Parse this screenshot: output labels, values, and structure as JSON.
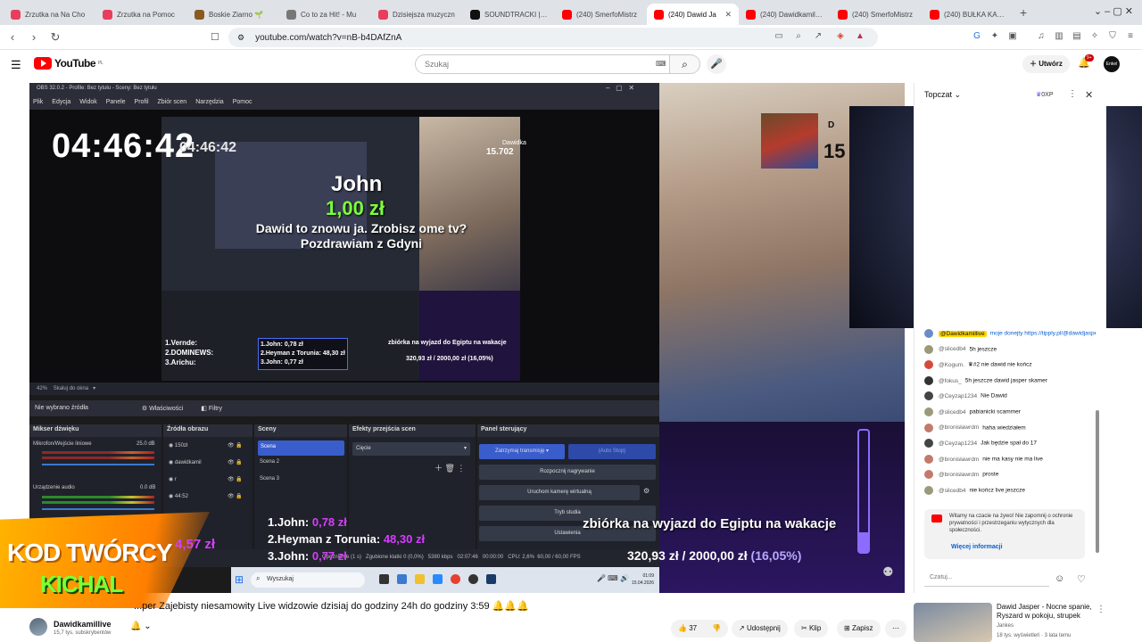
{
  "browser": {
    "tabs": [
      {
        "label": "Zrzutka na Na Cho",
        "color": "#e83e5c"
      },
      {
        "label": "Zrzutka na Pomoc",
        "color": "#e83e5c"
      },
      {
        "label": "Boskie Ziarno 🌱",
        "color": "#8a5a20"
      },
      {
        "label": "Co to za Hit! - Mu",
        "color": "#777777"
      },
      {
        "label": "Dzisiejsza muzyczn",
        "color": "#e83e5c"
      },
      {
        "label": "SOUNDTRACKI | Ja",
        "color": "#111111"
      },
      {
        "label": "(240) SmerfoMistrz",
        "color": "#ff0000"
      },
      {
        "label": "(240) Dawid Ja",
        "color": "#ff0000",
        "active": true
      },
      {
        "label": "(240) Dawidkamillive",
        "color": "#ff0000"
      },
      {
        "label": "(240) SmerfoMistrz",
        "color": "#ff0000"
      },
      {
        "label": "(240) BUŁKA KARU",
        "color": "#ff0000"
      }
    ],
    "url": "youtube.com/watch?v=nB-b4DAfZnA"
  },
  "youtube": {
    "logo": "YouTube",
    "logo_country": "PL",
    "search_placeholder": "Szukaj",
    "create_label": "Utwórz",
    "notif_count": "9+",
    "avatar_text": "Enkel"
  },
  "obs": {
    "title": "OBS 32.0.2 - Profile: Bez tytułu - Sceny: Bez tytułu",
    "menu": [
      "Plik",
      "Edycja",
      "Widok",
      "Panele",
      "Profil",
      "Zbiór scen",
      "Narzędzia",
      "Pomoc"
    ],
    "clock": "04:46:42",
    "clock_small": "04:46:42",
    "status_zoom": "42%",
    "status_fit": "Skaluj do okna",
    "no_source": "Nie wybrano źródła",
    "props": "Właściwości",
    "filters": "Filtry",
    "panel_mixer": "Mikser dźwięku",
    "mic_label": "Mikrofon/Wejście liniowe",
    "mic_db": "25.0 dB",
    "desk_label": "Urządzenie audio",
    "desk_db": "0.0 dB",
    "panel_sources": "Źródła obrazu",
    "sources": [
      "150zł",
      "dawidkamil",
      "r",
      "44:52"
    ],
    "panel_scenes": "Sceny",
    "scenes": [
      "Scena",
      "Scena 2",
      "Scena 3"
    ],
    "panel_transitions": "Efekty przejścia scen",
    "transition": "Cięcie",
    "panel_controls": "Panel sterujący",
    "stop_stream": "Zatrzymaj transmisję",
    "auto_stop": "(Auto Stop)",
    "start_rec": "Rozpocznij nagrywanie",
    "virtual_cam": "Uruchom kamerę wirtualną",
    "studio": "Tryb studia",
    "settings": "Ustawienia",
    "status_delay": "Opóźnienie (1 s)",
    "status_dropped": "Zgubione klatki 0 (0,0%)",
    "status_kbps": "5380 kbps",
    "status_time": "02:07:46",
    "status_rec": "00:00:00",
    "status_cpu": "CPU: 2,6%",
    "status_fps": "60,00 / 60,00 FPS"
  },
  "donation": {
    "name": "John",
    "amount": "1,00 zł",
    "message": "Dawid to znowu ja. Zrobisz ome tv? Pozdrawiam z Gdyni"
  },
  "nested": {
    "label": "Dawidka",
    "count": "15.702",
    "list": [
      "1.Vernde:",
      "2.DOMINEWS:",
      "3.Arichu:"
    ],
    "list2": [
      "1.John: 0,78 zł",
      "2.Heyman z Torunia: 48,30 zł",
      "3.John: 0,77 zł"
    ],
    "zb": "zbiórka na wyjazd do Egiptu na wakacje",
    "zb_amt": "320,93 zł / 2000,00 zł (16,05%)"
  },
  "cam": {
    "label": "D",
    "count": "15"
  },
  "ranking": [
    {
      "pos": "1.John:",
      "amt": "0,78 zł"
    },
    {
      "pos": "2.Heyman z Torunia:",
      "amt": "48,30 zł"
    },
    {
      "pos": "3.John:",
      "amt": "0,77 zł"
    }
  ],
  "fundraiser": {
    "title": "zbiórka na wyjazd do Egiptu na wakacje",
    "amount": "320,93 zł / 2000,00 zł",
    "percent": "(16,05%)",
    "progress": 0.1605
  },
  "taskbar": {
    "search": "Wyszukaj",
    "time": "01:09",
    "date": "15.04.2026"
  },
  "badge": {
    "line1": "KOD TWÓRCY",
    "line2": "KICHAL",
    "amount": "4,57 zł"
  },
  "chat": {
    "header": "Topczat",
    "xp": "0XP",
    "messages": [
      {
        "user": "@Dawidkamillive",
        "text": "moje donejty https://tipply.pl/@dawidjasper_38",
        "hl": true,
        "color": "#6a8cc7"
      },
      {
        "user": "@slicedb4",
        "text": "5h jeszcze",
        "color": "#9a9a7a"
      },
      {
        "user": "@Kogum.",
        "text": "♛#2  nie dawid nie kończ",
        "color": "#d64a3a"
      },
      {
        "user": "@fokus_",
        "text": "5h jeszcze dawid jasper skamer",
        "color": "#333333"
      },
      {
        "user": "@Ceyzap1234",
        "text": "Nie Dawid",
        "color": "#444444"
      },
      {
        "user": "@slicedb4",
        "text": "pabianicki scammer",
        "color": "#9a9a7a"
      },
      {
        "user": "@bronisławrdm",
        "text": "haha wiedziałem",
        "color": "#c27a6a"
      },
      {
        "user": "@Ceyzap1234",
        "text": "Jak będzie spał do 17",
        "color": "#444444"
      },
      {
        "user": "@bronisławrdm",
        "text": "nie ma kasy nie ma live",
        "color": "#c27a6a"
      },
      {
        "user": "@bronisławrdm",
        "text": "proste",
        "color": "#c27a6a"
      },
      {
        "user": "@slicedb4",
        "text": "nie kończ live jeszcze",
        "color": "#9a9a7a"
      }
    ],
    "notice": "Witamy na czacie na żywo! Nie zapomnij o ochronie prywatności i przestrzeganiu wytycznych dla społeczności.",
    "notice_link": "Więcej informacji",
    "input_placeholder": "Czatuj..."
  },
  "video": {
    "title": "...per Zajebisty niesamowity Live widzowie dzisiaj do godziny 24h do godziny 3:59 🔔🔔🔔",
    "channel": "Dawidkamillive",
    "subs": "15,7 tys. subskrybentów",
    "likes": "37",
    "share": "Udostępnij",
    "clip": "Klip",
    "save": "Zapisz"
  },
  "related": {
    "title": "Dawid Jasper - Nocne spanie, Ryszard w pokoju, strupek",
    "channel": "Jankes",
    "meta": "18 tys. wyświetleń · 3 lata temu"
  }
}
